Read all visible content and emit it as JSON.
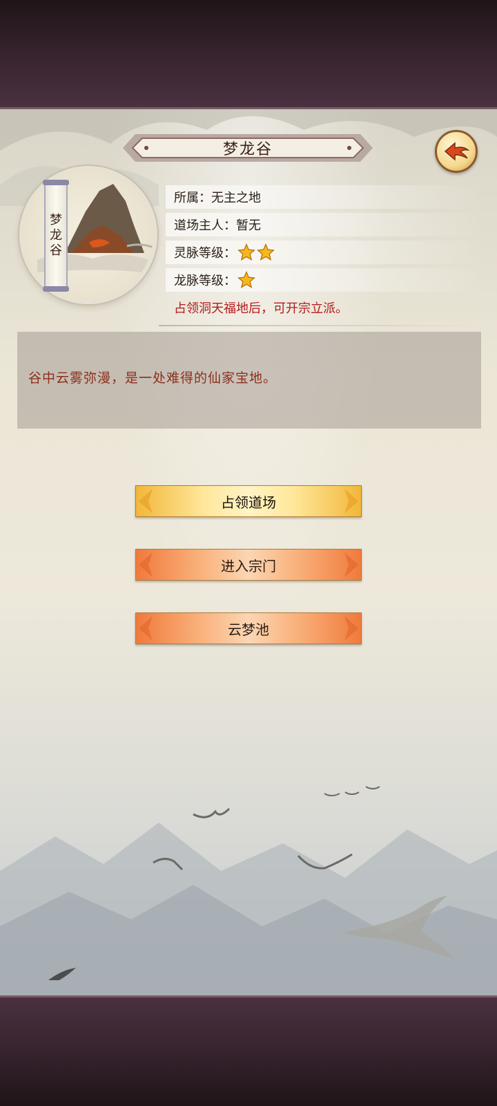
{
  "header": {
    "title": "梦龙谷",
    "back_icon": "back-arrow-icon"
  },
  "location": {
    "banner_text": "梦龙谷",
    "info": {
      "affiliation": "所属：无主之地",
      "owner": "道场主人：暂无",
      "spirit_vein_label": "灵脉等级：",
      "spirit_vein_stars": 2,
      "dragon_vein_label": "龙脉等级：",
      "dragon_vein_stars": 1
    },
    "notice": "占领洞天福地后，可开宗立派。",
    "description": "谷中云雾弥漫，是一处难得的仙家宝地。"
  },
  "actions": {
    "occupy": "占领道场",
    "enter_sect": "进入宗门",
    "cloud_pool": "云梦池"
  },
  "colors": {
    "notice": "#b31a1a",
    "description": "#8c2e1c",
    "button_gold": "#ffe79a",
    "button_orange": "#f9b07a",
    "star": "#f5b91e"
  }
}
